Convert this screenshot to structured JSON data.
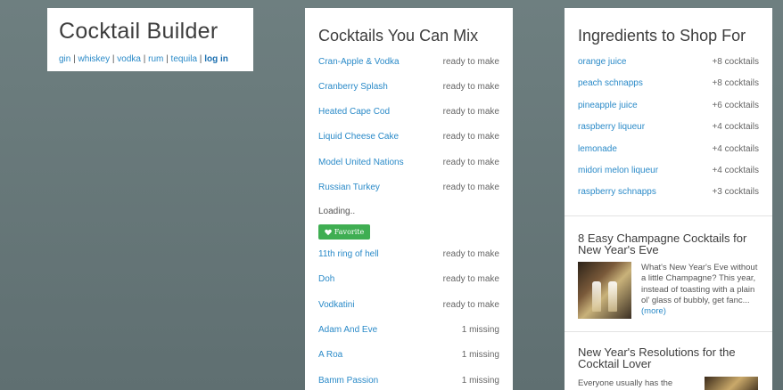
{
  "brand": {
    "title": "Cocktail Builder",
    "nav": [
      {
        "label": "gin"
      },
      {
        "label": "whiskey"
      },
      {
        "label": "vodka"
      },
      {
        "label": "rum"
      },
      {
        "label": "tequila"
      }
    ],
    "login_label": "log in",
    "separator": "|"
  },
  "mix": {
    "title": "Cocktails You Can Mix",
    "rows": [
      {
        "name": "Cran-Apple & Vodka",
        "status": "ready to make"
      },
      {
        "name": "Cranberry Splash",
        "status": "ready to make"
      },
      {
        "name": "Heated Cape Cod",
        "status": "ready to make"
      },
      {
        "name": "Liquid Cheese Cake",
        "status": "ready to make"
      },
      {
        "name": "Model United Nations",
        "status": "ready to make"
      },
      {
        "name": "Russian Turkey",
        "status": "ready to make"
      }
    ],
    "loading": "Loading..",
    "favorite_label": "Favorite",
    "rows2": [
      {
        "name": "11th ring of hell",
        "status": "ready to make"
      },
      {
        "name": "Doh",
        "status": "ready to make"
      },
      {
        "name": "Vodkatini",
        "status": "ready to make"
      },
      {
        "name": "Adam And Eve",
        "status": "1 missing"
      },
      {
        "name": "A Roa",
        "status": "1 missing"
      },
      {
        "name": "Bamm Passion",
        "status": "1 missing"
      }
    ]
  },
  "shop": {
    "title": "Ingredients to Shop For",
    "items": [
      {
        "name": "orange juice",
        "count": "+8 cocktails"
      },
      {
        "name": "peach schnapps",
        "count": "+8 cocktails"
      },
      {
        "name": "pineapple juice",
        "count": "+6 cocktails"
      },
      {
        "name": "raspberry liqueur",
        "count": "+4 cocktails"
      },
      {
        "name": "lemonade",
        "count": "+4 cocktails"
      },
      {
        "name": "midori melon liqueur",
        "count": "+4 cocktails"
      },
      {
        "name": "raspberry schnapps",
        "count": "+3 cocktails"
      }
    ],
    "article1": {
      "title": "8 Easy Champagne Cocktails for New Year's Eve",
      "excerpt": "What's New Year's Eve without a little Champagne? This year, instead of toasting with a plain ol' glass of bubbly, get fanc...",
      "more": "(more)"
    },
    "article2": {
      "title": "New Year's Resolutions for the Cocktail Lover",
      "excerpt": "Everyone usually has the"
    }
  },
  "colors": {
    "link": "#2a8ac8",
    "favorite": "#3fae52",
    "background": "#667879"
  }
}
